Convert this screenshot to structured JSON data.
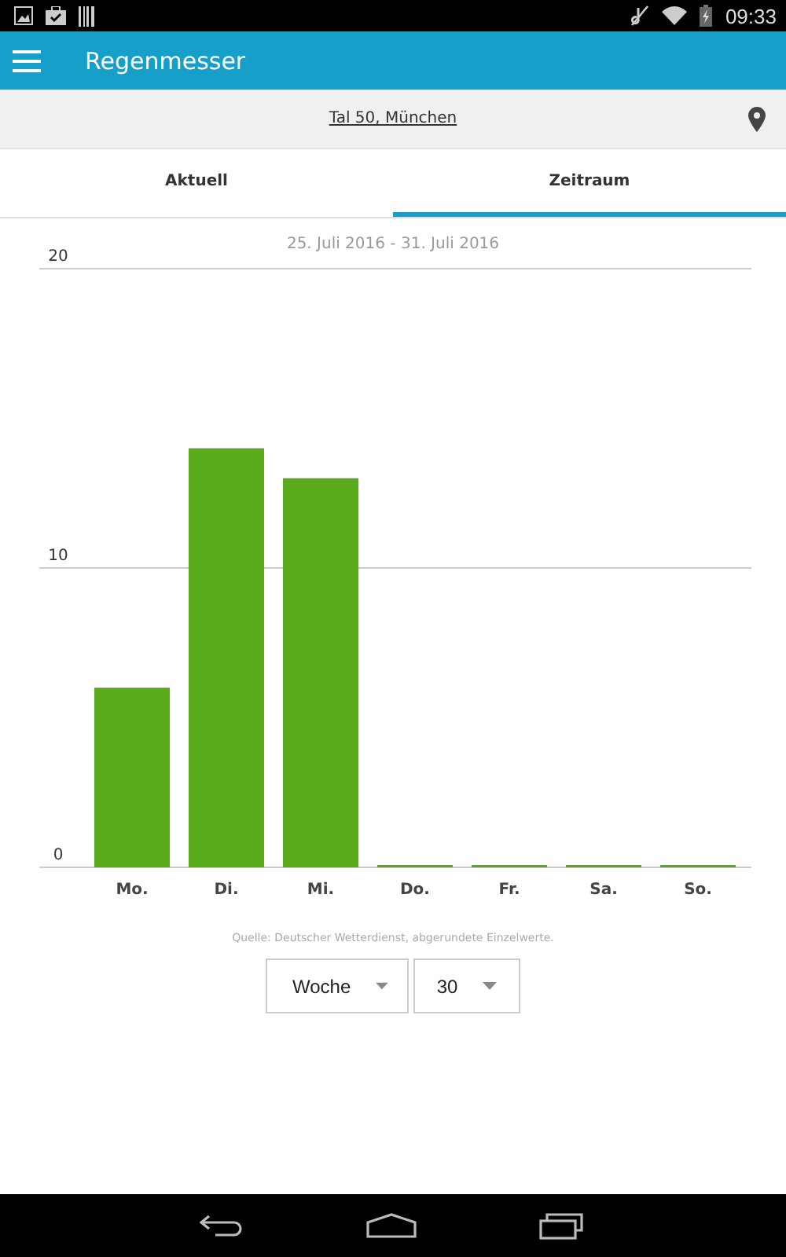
{
  "status_bar": {
    "time": "09:33"
  },
  "app_bar": {
    "title": "Regenmesser"
  },
  "location": {
    "address": "Tal 50, München"
  },
  "tabs": [
    {
      "label": "Aktuell",
      "selected": false
    },
    {
      "label": "Zeitraum",
      "selected": true
    }
  ],
  "date_range": "25. Juli 2016 - 31. Juli 2016",
  "chart_data": {
    "type": "bar",
    "categories": [
      "Mo.",
      "Di.",
      "Mi.",
      "Do.",
      "Fr.",
      "Sa.",
      "So."
    ],
    "series": [
      {
        "color": "#5aab1c",
        "values": [
          6,
          14,
          13,
          0,
          0,
          0,
          0
        ]
      }
    ],
    "ylim": [
      0,
      20
    ],
    "yticks": [
      0,
      10,
      20
    ]
  },
  "source_note": "Quelle: Deutscher Wetterdienst, abgerundete Einzelwerte.",
  "dropdowns": [
    {
      "value": "Woche"
    },
    {
      "value": "30"
    }
  ]
}
